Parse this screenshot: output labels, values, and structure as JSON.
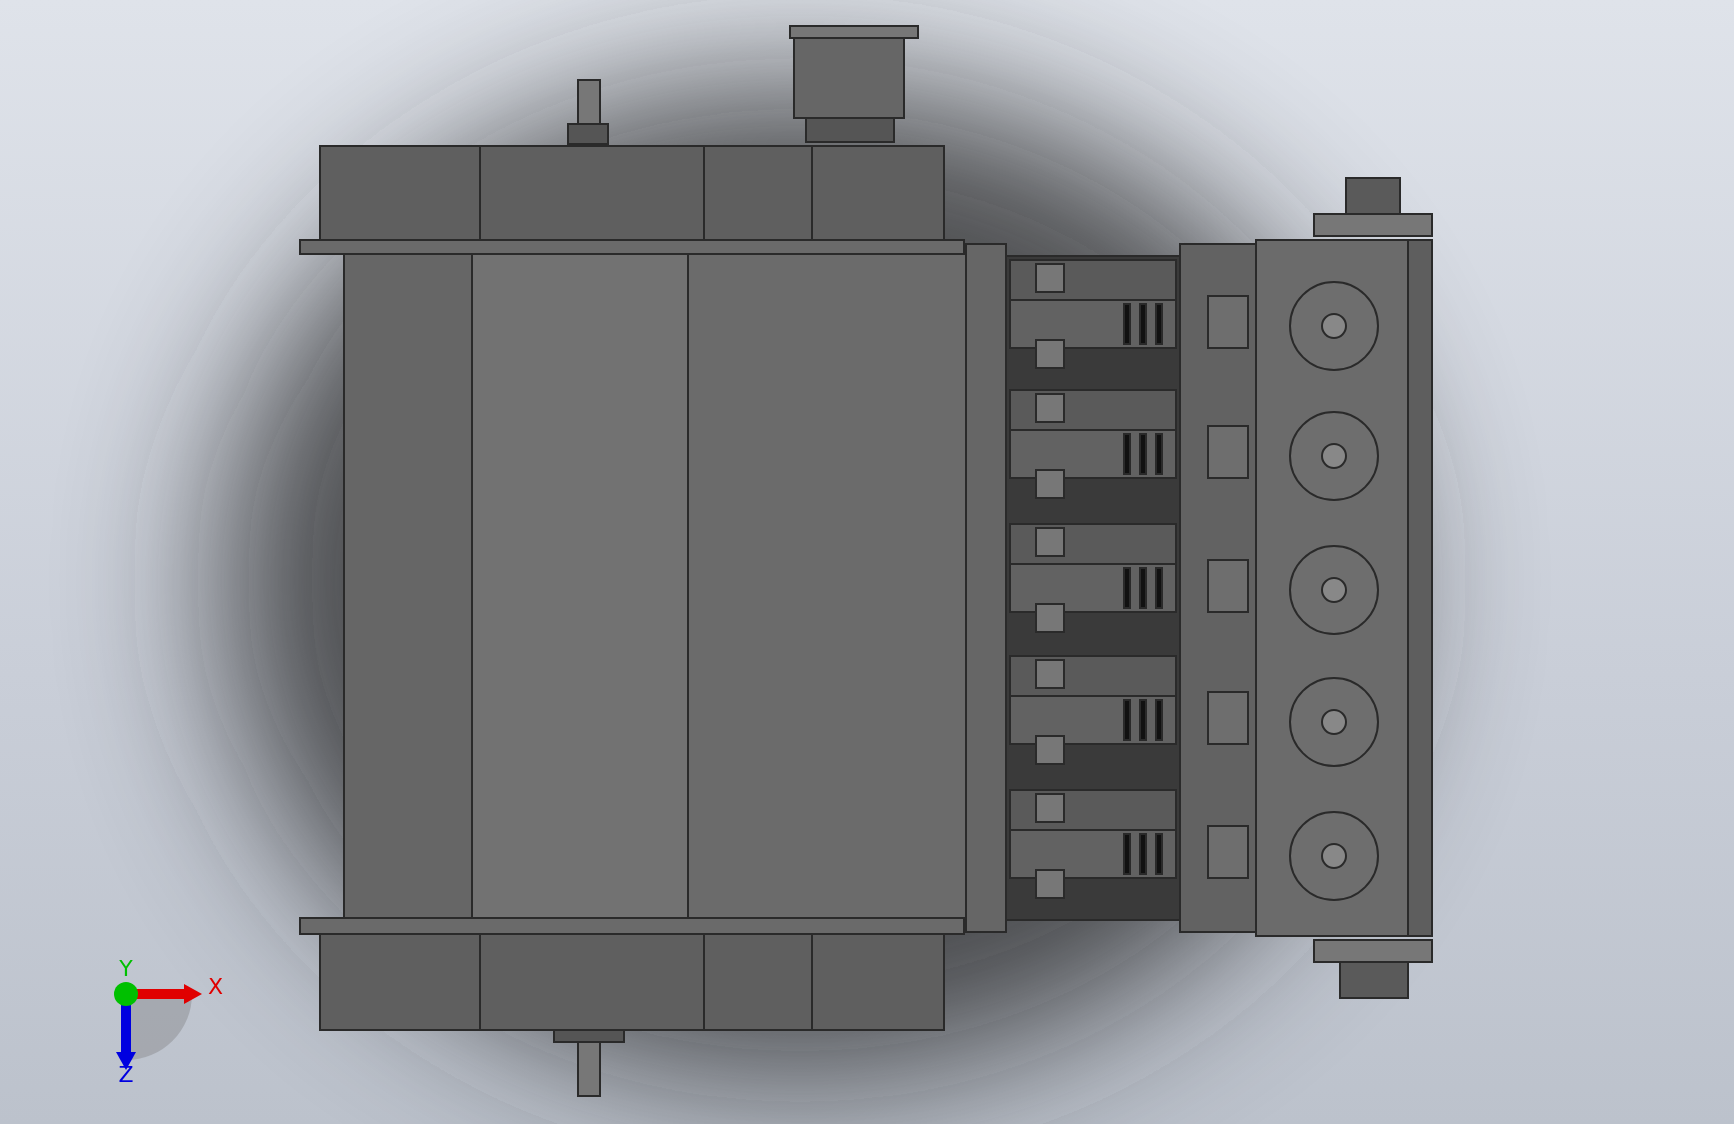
{
  "viewport": {
    "triad": {
      "axes": [
        {
          "label": "X",
          "color": "#e00000"
        },
        {
          "label": "Y",
          "color": "#00c000"
        },
        {
          "label": "Z",
          "color": "#0000e0"
        }
      ]
    }
  }
}
